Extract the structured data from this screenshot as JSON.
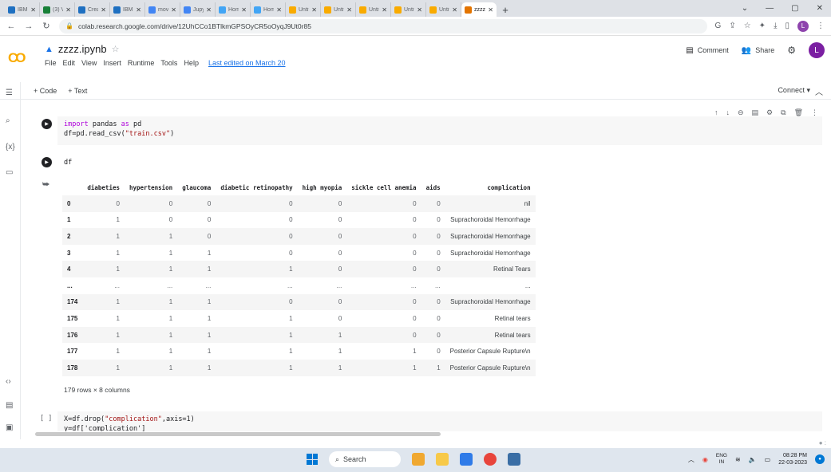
{
  "browser": {
    "tabs": [
      {
        "label": "IBM",
        "fav": "#1f70c1"
      },
      {
        "label": "(3) Vi",
        "fav": "#188038"
      },
      {
        "label": "Crea",
        "fav": "#1f70c1"
      },
      {
        "label": "IBM",
        "fav": "#1f70c1"
      },
      {
        "label": "mov",
        "fav": "#4285f4"
      },
      {
        "label": "Jupyt",
        "fav": "#4285f4"
      },
      {
        "label": "Hom",
        "fav": "#42a5f5"
      },
      {
        "label": "Hom",
        "fav": "#42a5f5"
      },
      {
        "label": "Untit",
        "fav": "#f9ab00"
      },
      {
        "label": "Untit",
        "fav": "#f9ab00"
      },
      {
        "label": "Untit",
        "fav": "#f9ab00"
      },
      {
        "label": "Untit",
        "fav": "#f9ab00"
      },
      {
        "label": "Untit",
        "fav": "#f9ab00"
      },
      {
        "label": "zzzz",
        "fav": "#e37400",
        "active": true
      }
    ],
    "url": "colab.research.google.com/drive/12UhCCo1BTlkmGPSOyCR5oOyqJ9Ut0r85",
    "profile_initial": "L"
  },
  "colab": {
    "notebook_name": "zzzz.ipynb",
    "menu": [
      "File",
      "Edit",
      "View",
      "Insert",
      "Runtime",
      "Tools",
      "Help"
    ],
    "last_edited": "Last edited on March 20",
    "comment_label": "Comment",
    "share_label": "Share",
    "avatar_initial": "L",
    "add_code": "+ Code",
    "add_text": "+ Text",
    "connect_label": "Connect"
  },
  "cells": {
    "cell1_line1_kw1": "import",
    "cell1_line1_mid": " pandas ",
    "cell1_line1_kw2": "as",
    "cell1_line1_end": " pd",
    "cell1_line2_pre": "df=pd.read_csv(",
    "cell1_line2_str": "\"train.csv\"",
    "cell1_line2_post": ")",
    "cell2_code": "df",
    "cell3_prompt": "[ ]",
    "cell3_line1_pre": "X=df.drop(",
    "cell3_line1_str": "\"complication\"",
    "cell3_line1_post": ",axis=1)",
    "cell3_line2": "y=df['complication']"
  },
  "output": {
    "columns": [
      "",
      "diabeties",
      "hypertension",
      "glaucoma",
      "diabetic retinopathy",
      "high myopia",
      "sickle cell anemia",
      "aids",
      "complication"
    ],
    "rows": [
      [
        "0",
        "0",
        "0",
        "0",
        "0",
        "0",
        "0",
        "0",
        "nil"
      ],
      [
        "1",
        "1",
        "0",
        "0",
        "0",
        "0",
        "0",
        "0",
        "Suprachoroidal Hemorrhage"
      ],
      [
        "2",
        "1",
        "1",
        "0",
        "0",
        "0",
        "0",
        "0",
        "Suprachoroidal Hemorrhage"
      ],
      [
        "3",
        "1",
        "1",
        "1",
        "0",
        "0",
        "0",
        "0",
        "Suprachoroidal Hemorrhage"
      ],
      [
        "4",
        "1",
        "1",
        "1",
        "1",
        "0",
        "0",
        "0",
        "Retinal Tears"
      ],
      [
        "...",
        "...",
        "...",
        "...",
        "...",
        "...",
        "...",
        "...",
        "..."
      ],
      [
        "174",
        "1",
        "1",
        "1",
        "0",
        "0",
        "0",
        "0",
        "Suprachoroidal Hemorrhage"
      ],
      [
        "175",
        "1",
        "1",
        "1",
        "1",
        "0",
        "0",
        "0",
        "Retinal tears"
      ],
      [
        "176",
        "1",
        "1",
        "1",
        "1",
        "1",
        "0",
        "0",
        "Retinal tears"
      ],
      [
        "177",
        "1",
        "1",
        "1",
        "1",
        "1",
        "1",
        "0",
        "Posterior Capsule Rupture\\n"
      ],
      [
        "178",
        "1",
        "1",
        "1",
        "1",
        "1",
        "1",
        "1",
        "Posterior Capsule Rupture\\n"
      ]
    ],
    "shape": "179 rows × 8 columns"
  },
  "taskbar": {
    "search_label": "Search",
    "lang_line1": "ENG",
    "lang_line2": "IN",
    "time": "08:28 PM",
    "date": "22-03-2023"
  }
}
